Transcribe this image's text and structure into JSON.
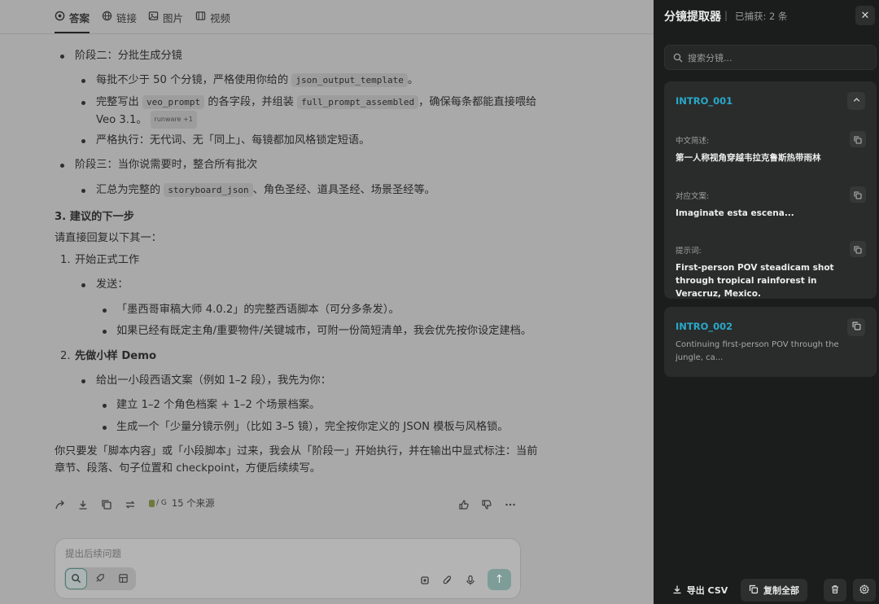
{
  "tabs": [
    {
      "label": "答案",
      "icon": "sparkle-icon",
      "active": true
    },
    {
      "label": "链接",
      "icon": "globe-icon",
      "active": false
    },
    {
      "label": "图片",
      "icon": "image-icon",
      "active": false
    },
    {
      "label": "视频",
      "icon": "video-icon",
      "active": false
    }
  ],
  "content": {
    "stage2": "阶段二：分批生成分镜",
    "s2_b1_a": "每批不少于 50 个分镜，严格使用你给的",
    "s2_b1_code": "json_output_template",
    "s2_b1_b": "。",
    "s2_b2_a": "完整写出",
    "s2_b2_code1": "veo_prompt",
    "s2_b2_b": "的各字段，并组装",
    "s2_b2_code2": "full_prompt_assembled",
    "s2_b2_c": "，确保每条都能直接喂给",
    "s2_b2_d": "Veo 3.1。",
    "s2_b2_badge": "runware +1",
    "s2_b3": "严格执行：无代词、无「同上」、每镜都加风格锁定短语。",
    "stage3": "阶段三：当你说需要时，整合所有批次",
    "s3_b1_a": "汇总为完整的",
    "s3_b1_code": "storyboard_json",
    "s3_b1_b": "、角色圣经、道具圣经、场景圣经等。",
    "h3": "3. 建议的下一步",
    "reply_intro": "请直接回复以下其一：",
    "opt1_num": "1.",
    "opt1": "开始正式工作",
    "opt1_send": "发送：",
    "opt1_s1": "「墨西哥审稿大师 4.0.2」的完整西语脚本（可分多条发）。",
    "opt1_s2": "如果已经有既定主角/重要物件/关键城市，可附一份简短清单，我会优先按你设定建档。",
    "opt2_num": "2.",
    "opt2": "先做小样 Demo",
    "opt2_b1": "给出一小段西语文案（例如 1–2 段），我先为你：",
    "opt2_s1": "建立 1–2 个角色档案 + 1–2 个场景档案。",
    "opt2_s2": "生成一个「少量分镜示例」（比如 3–5 镜），完全按你定义的 JSON 模板与风格锁。",
    "final_1": "你只要发「脚本内容」或「小段脚本」过来，我会从「阶段一」开始执行，并在输出中显式标注：当前",
    "final_2": "章节、段落、句子位置和 checkpoint，方便后续续写。"
  },
  "actions": {
    "sources_label": "15 个来源",
    "source_icons": "/ G"
  },
  "composer": {
    "placeholder": "提出后续问题"
  },
  "panel": {
    "title": "分镜提取器",
    "separator": "|",
    "count": "已捕获: 2 条",
    "close": "✕",
    "search_placeholder": "搜索分镜...",
    "cards": [
      {
        "id": "INTRO_001",
        "expanded": true,
        "fields": [
          {
            "label": "中文简述:",
            "value": "第一人称视角穿越韦拉克鲁斯热带雨林"
          },
          {
            "label": "对应文案:",
            "value": "Imaginate esta escena..."
          },
          {
            "label": "提示词:",
            "value": "First-person POV steadicam shot through tropical rainforest in Veracruz, Mexico."
          }
        ]
      },
      {
        "id": "INTRO_002",
        "expanded": false,
        "preview": "Continuing first-person POV through the jungle, ca..."
      }
    ],
    "export_csv": "导出 CSV",
    "copy_all": "复制全部"
  },
  "colors": {
    "accent_id": "#28a9c9",
    "panel_bg": "#1b1c1c",
    "card_bg": "#2a2b2b",
    "overlay_bg": "#a8a9a8"
  }
}
